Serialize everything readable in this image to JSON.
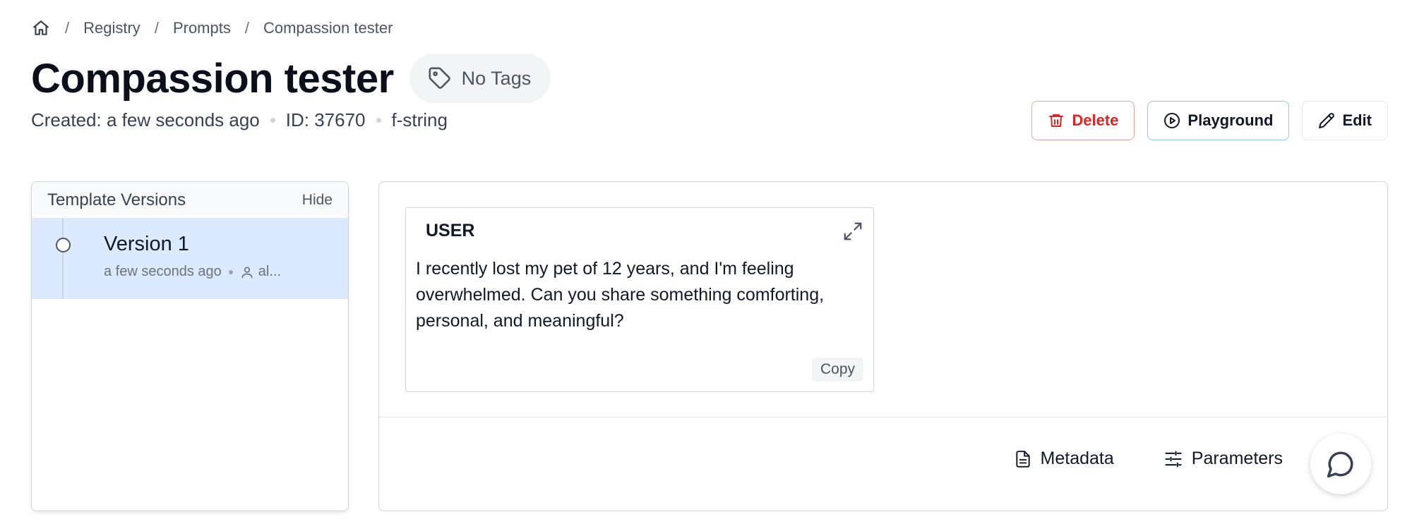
{
  "breadcrumb": {
    "home_icon": "home-icon",
    "items": [
      "Registry",
      "Prompts",
      "Compassion tester"
    ]
  },
  "page": {
    "title": "Compassion tester",
    "tags_label": "No Tags",
    "meta": {
      "created": "Created: a few seconds ago",
      "id": "ID: 37670",
      "format": "f-string"
    }
  },
  "actions": {
    "delete_label": "Delete",
    "playground_label": "Playground",
    "edit_label": "Edit"
  },
  "versions": {
    "title": "Template Versions",
    "hide_label": "Hide",
    "items": [
      {
        "name": "Version 1",
        "time": "a few seconds ago",
        "author": "al..."
      }
    ]
  },
  "message": {
    "role": "USER",
    "text": "I recently lost my pet of 12 years, and I'm feeling overwhelmed. Can you share something comforting, personal, and meaningful?",
    "copy_label": "Copy"
  },
  "footer": {
    "metadata_label": "Metadata",
    "parameters_label": "Parameters"
  },
  "colors": {
    "danger": "#dc2626",
    "selected_bg": "#dbeafe",
    "primary_border": "#93c5fd"
  }
}
